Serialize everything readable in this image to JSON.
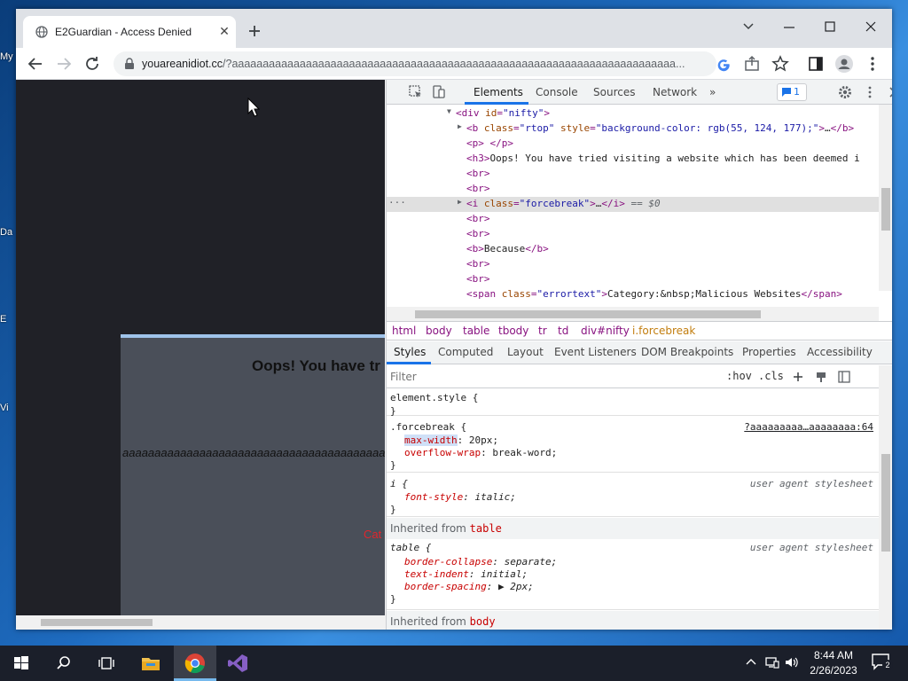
{
  "desktop": {
    "icons": [
      "My",
      "Da",
      "E",
      "Vi"
    ]
  },
  "browser": {
    "tab_title": "E2Guardian - Access Denied",
    "url_host": "youareanidiot.cc",
    "url_rest": "/?aaaaaaaaaaaaaaaaaaaaaaaaaaaaaaaaaaaaaaaaaaaaaaaaaaaaaaaaaaaaaaaaaaaaaaaa..."
  },
  "page": {
    "heading": "Oops! You have tr",
    "long_text": "aaaaaaaaaaaaaaaaaaaaaaaaaaaaaaaaaaaaaaaaaaaaaaaaaaaaaaaaa",
    "category": "Cat"
  },
  "devtools": {
    "tabs": [
      "Elements",
      "Console",
      "Sources",
      "Network"
    ],
    "more": "»",
    "issues_count": "1",
    "elements": [
      {
        "indent": 0,
        "arrow": "▼",
        "html": "<span class='tag'>&lt;div </span><span class='an'>id</span><span class='tag'>=</span><span class='av'>\"nifty\"</span><span class='tag'>&gt;</span>"
      },
      {
        "indent": 1,
        "arrow": "▶",
        "html": "<span class='tag'>&lt;b </span><span class='an'>class</span><span class='tag'>=</span><span class='av'>\"rtop\"</span> <span class='an'>style</span><span class='tag'>=</span><span class='av'>\"background-color: rgb(55, 124, 177);\"</span><span class='tag'>&gt;</span><span class='txt'>…</span><span class='tag'>&lt;/b&gt;</span>"
      },
      {
        "indent": 1,
        "arrow": "",
        "html": "<span class='tag'>&lt;p&gt;</span><span class='txt'> </span><span class='tag'>&lt;/p&gt;</span>"
      },
      {
        "indent": 1,
        "arrow": "",
        "html": "<span class='tag'>&lt;h3&gt;</span><span class='txt'>Oops! You have tried visiting a website which has been deemed i</span>"
      },
      {
        "indent": 1,
        "arrow": "",
        "html": "<span class='tag'>&lt;br&gt;</span>"
      },
      {
        "indent": 1,
        "arrow": "",
        "html": "<span class='tag'>&lt;br&gt;</span>"
      },
      {
        "indent": 1,
        "arrow": "▶",
        "selected": true,
        "html": "<span class='tag'>&lt;i </span><span class='an'>class</span><span class='tag'>=</span><span class='av'>\"forcebreak\"</span><span class='tag'>&gt;</span><span class='txt'>…</span><span class='tag'>&lt;/i&gt;</span> <span class='eq'>== <i>$0</i></span>"
      },
      {
        "indent": 1,
        "arrow": "",
        "html": "<span class='tag'>&lt;br&gt;</span>"
      },
      {
        "indent": 1,
        "arrow": "",
        "html": "<span class='tag'>&lt;br&gt;</span>"
      },
      {
        "indent": 1,
        "arrow": "",
        "html": "<span class='tag'>&lt;b&gt;</span><span class='txt'>Because</span><span class='tag'>&lt;/b&gt;</span>"
      },
      {
        "indent": 1,
        "arrow": "",
        "html": "<span class='tag'>&lt;br&gt;</span>"
      },
      {
        "indent": 1,
        "arrow": "",
        "html": "<span class='tag'>&lt;br&gt;</span>"
      },
      {
        "indent": 1,
        "arrow": "",
        "html": "<span class='tag'>&lt;span </span><span class='an'>class</span><span class='tag'>=</span><span class='av'>\"errortext\"</span><span class='tag'>&gt;</span><span class='txt'>Category:&amp;nbsp;Malicious Websites</span><span class='tag'>&lt;/span&gt;</span>"
      }
    ],
    "breadcrumbs": [
      "html",
      "body",
      "table",
      "tbody",
      "tr",
      "td",
      "div#nifty",
      "i.forcebreak"
    ],
    "subtabs": [
      "Styles",
      "Computed",
      "Layout",
      "Event Listeners",
      "DOM Breakpoints",
      "Properties",
      "Accessibility"
    ],
    "filter_placeholder": "Filter",
    "filter_hov": ":hov",
    "filter_cls": ".cls",
    "styles": {
      "element_style": "element.style {",
      "forcebreak_selector": ".forcebreak {",
      "forcebreak_source": "?aaaaaaaaa…aaaaaaaa:64",
      "decl1_prop": "max-width",
      "decl1_val": ": 20px;",
      "decl2_prop": "overflow-wrap",
      "decl2_val": ": break-word;",
      "i_selector": "i {",
      "ua_label": "user agent stylesheet",
      "i_prop": "font-style",
      "i_val": ": italic;",
      "inherited_label": "Inherited from ",
      "inherited_table": "table",
      "table_selector": "table {",
      "t_prop1": "border-collapse",
      "t_val1": ": separate;",
      "t_prop2": "text-indent",
      "t_val2": ": initial;",
      "t_prop3": "border-spacing",
      "t_val3": ": ▶ 2px;",
      "close_brace": "}",
      "inherited_body": "body"
    }
  },
  "taskbar": {
    "time": "8:44 AM",
    "date": "2/26/2023",
    "notifications": "2"
  }
}
